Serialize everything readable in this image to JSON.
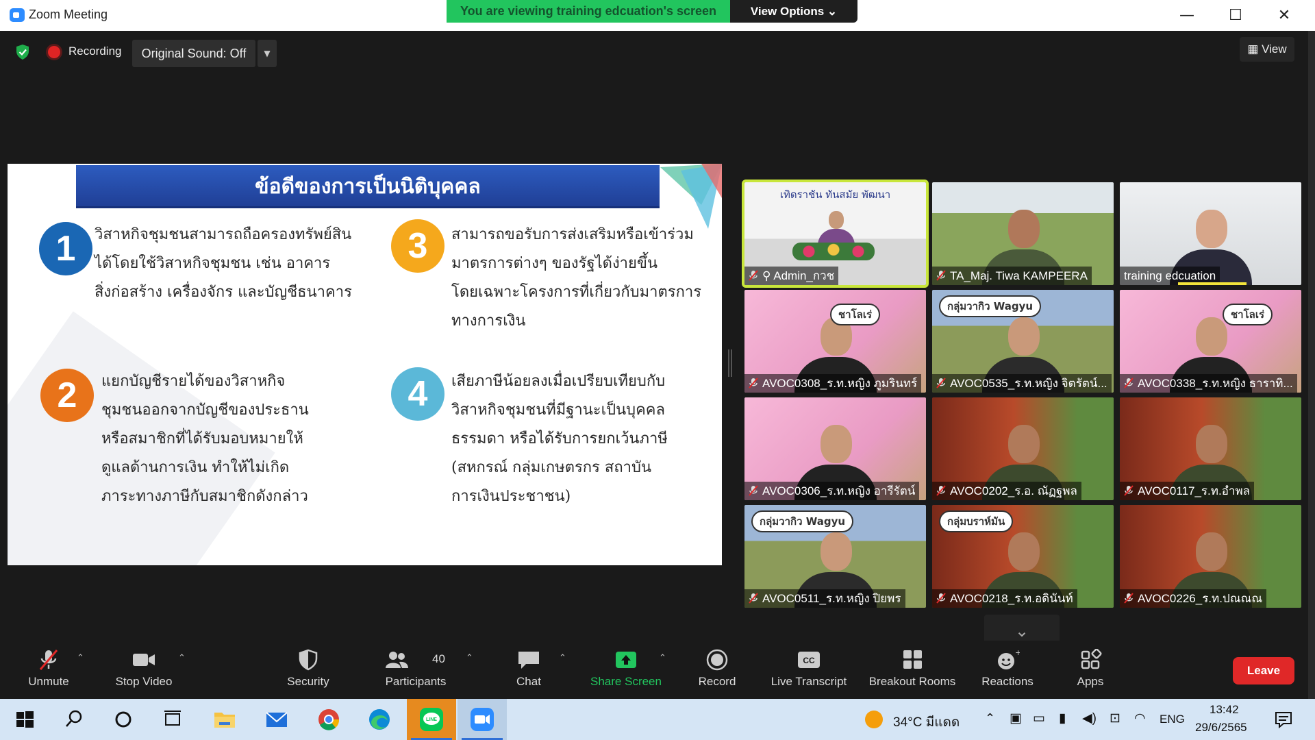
{
  "window": {
    "title": "Zoom Meeting",
    "banner": "You are viewing training edcuation's screen",
    "view_options": "View Options",
    "minimize": "—",
    "maximize": "☐",
    "close": "✕"
  },
  "top_controls": {
    "recording_label": "Recording",
    "original_sound": "Original Sound: Off",
    "view_label": "View"
  },
  "slide": {
    "title": "ข้อดีของการเป็นนิติบุคคล",
    "points": [
      {
        "number": "1",
        "color": "#1a67b4",
        "lines": [
          "วิสาหกิจชุมชนสามารถถือครองทรัพย์สิน",
          "ได้โดยใช้วิสาหกิจชุมชน เช่น อาคาร",
          "สิ่งก่อสร้าง เครื่องจักร และบัญชีธนาคาร"
        ]
      },
      {
        "number": "3",
        "color": "#f5a81c",
        "lines": [
          "สามารถขอรับการส่งเสริมหรือเข้าร่วม",
          "มาตรการต่างๆ ของรัฐได้ง่ายขึ้น",
          "โดยเฉพาะโครงการที่เกี่ยวกับมาตรการ",
          "ทางการเงิน"
        ]
      },
      {
        "number": "2",
        "color": "#e8731a",
        "lines": [
          "แยกบัญชีรายได้ของวิสาหกิจ",
          "ชุมชนออกจากบัญชีของประธาน",
          "หรือสมาชิกที่ได้รับมอบหมายให้",
          "ดูแลด้านการเงิน ทำให้ไม่เกิด",
          "ภาระทางภาษีกับสมาชิกดังกล่าว"
        ]
      },
      {
        "number": "4",
        "color": "#5bb8d8",
        "lines": [
          "เสียภาษีน้อยลงเมื่อเปรียบเทียบกับ",
          "วิสาหกิจชุมชนที่มีฐานะเป็นบุคคล",
          "ธรรมดา หรือได้รับการยกเว้นภาษี",
          "(สหกรณ์ กลุ่มเกษตรกร สถาบัน",
          "การเงินประชาชน)"
        ]
      }
    ]
  },
  "participants_grid": [
    {
      "name": "Admin_กวช",
      "scene": "room",
      "banner": "เทิดราชัน  ทันสมัย  พัฒนา"
    },
    {
      "name": "TA_Maj. Tiwa KAMPEERA",
      "scene": "field"
    },
    {
      "name": "training edcuation",
      "scene": "plain",
      "no_mic_icon": true
    },
    {
      "name": "AVOC0308_ร.ท.หญิง ภูมรินทร์",
      "scene": "pink",
      "sign": "ชาโลเร่"
    },
    {
      "name": "AVOC0535_ร.ท.หญิง จิตรัตน์...",
      "scene": "pasture",
      "sign": "กลุ่มวากิว Wagyu"
    },
    {
      "name": "AVOC0338_ร.ท.หญิง ธาราทิ...",
      "scene": "pink",
      "sign": "ชาโลเร่"
    },
    {
      "name": "AVOC0306_ร.ท.หญิง อารีรัตน์",
      "scene": "pink"
    },
    {
      "name": "AVOC0202_ร.อ. ณัฏฐพล",
      "scene": "redcow"
    },
    {
      "name": "AVOC0117_ร.ท.อำพล",
      "scene": "redcow"
    },
    {
      "name": "AVOC0511_ร.ท.หญิง ปิยพร",
      "scene": "pasture",
      "sign": "กลุ่มวากิว Wagyu"
    },
    {
      "name": "AVOC0218_ร.ท.อดินันท์",
      "scene": "redcow",
      "sign": "กลุ่มบราห์มัน"
    },
    {
      "name": "AVOC0226_ร.ท.ปณณณ",
      "scene": "redcow"
    }
  ],
  "toolbar": {
    "unmute": "Unmute",
    "stop_video": "Stop Video",
    "security": "Security",
    "participants": "Participants",
    "participants_count": "40",
    "chat": "Chat",
    "share_screen": "Share Screen",
    "record": "Record",
    "live_transcript": "Live Transcript",
    "breakout_rooms": "Breakout Rooms",
    "reactions": "Reactions",
    "apps": "Apps",
    "leave": "Leave",
    "cc": "CC"
  },
  "taskbar": {
    "weather": "34°C  มีแดด",
    "language": "ENG",
    "time": "13:42",
    "date": "29/6/2565"
  },
  "colors": {
    "accent_green": "#22c55e",
    "active_speaker": "#c8e63b",
    "leave_red": "#e02828",
    "share_green": "#22c55e"
  }
}
